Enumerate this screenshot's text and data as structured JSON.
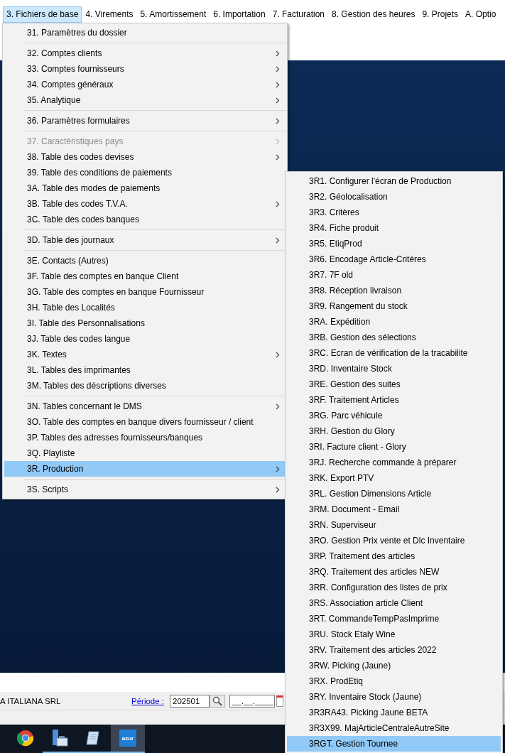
{
  "menubar": [
    {
      "label": "3. Fichiers de base",
      "selected": true
    },
    {
      "label": "4. Virements",
      "selected": false
    },
    {
      "label": "5. Amortissement",
      "selected": false
    },
    {
      "label": "6. Importation",
      "selected": false
    },
    {
      "label": "7. Facturation",
      "selected": false
    },
    {
      "label": "8. Gestion des heures",
      "selected": false
    },
    {
      "label": "9. Projets",
      "selected": false
    },
    {
      "label": "A. Optio",
      "selected": false
    }
  ],
  "menu": [
    {
      "kind": "item",
      "label": "31. Paramètres du dossier",
      "submenu": false,
      "disabled": false,
      "selected": false
    },
    {
      "kind": "separator"
    },
    {
      "kind": "item",
      "label": "32. Comptes clients",
      "submenu": true,
      "disabled": false,
      "selected": false
    },
    {
      "kind": "item",
      "label": "33. Comptes fournisseurs",
      "submenu": true,
      "disabled": false,
      "selected": false
    },
    {
      "kind": "item",
      "label": "34. Comptes généraux",
      "submenu": true,
      "disabled": false,
      "selected": false
    },
    {
      "kind": "item",
      "label": "35. Analytique",
      "submenu": true,
      "disabled": false,
      "selected": false
    },
    {
      "kind": "separator"
    },
    {
      "kind": "item",
      "label": "36. Paramètres formulaires",
      "submenu": true,
      "disabled": false,
      "selected": false
    },
    {
      "kind": "separator"
    },
    {
      "kind": "item",
      "label": "37. Caractèristiques pays",
      "submenu": true,
      "disabled": true,
      "selected": false
    },
    {
      "kind": "item",
      "label": "38. Table des codes devises",
      "submenu": true,
      "disabled": false,
      "selected": false
    },
    {
      "kind": "item",
      "label": "39. Table des conditions de paiements",
      "submenu": false,
      "disabled": false,
      "selected": false
    },
    {
      "kind": "item",
      "label": "3A. Table des modes de paiements",
      "submenu": false,
      "disabled": false,
      "selected": false
    },
    {
      "kind": "item",
      "label": "3B. Table des codes T.V.A.",
      "submenu": true,
      "disabled": false,
      "selected": false
    },
    {
      "kind": "item",
      "label": "3C. Table des codes banques",
      "submenu": false,
      "disabled": false,
      "selected": false
    },
    {
      "kind": "separator"
    },
    {
      "kind": "item",
      "label": "3D. Table des journaux",
      "submenu": true,
      "disabled": false,
      "selected": false
    },
    {
      "kind": "separator"
    },
    {
      "kind": "item",
      "label": "3E. Contacts (Autres)",
      "submenu": false,
      "disabled": false,
      "selected": false
    },
    {
      "kind": "item",
      "label": "3F. Table des comptes en banque Client",
      "submenu": false,
      "disabled": false,
      "selected": false
    },
    {
      "kind": "item",
      "label": "3G. Table des comptes en banque Fournisseur",
      "submenu": false,
      "disabled": false,
      "selected": false
    },
    {
      "kind": "item",
      "label": "3H. Table des Localités",
      "submenu": false,
      "disabled": false,
      "selected": false
    },
    {
      "kind": "item",
      "label": "3I. Table des Personnalisations",
      "submenu": false,
      "disabled": false,
      "selected": false
    },
    {
      "kind": "item",
      "label": "3J. Table des codes langue",
      "submenu": false,
      "disabled": false,
      "selected": false
    },
    {
      "kind": "item",
      "label": "3K. Textes",
      "submenu": true,
      "disabled": false,
      "selected": false
    },
    {
      "kind": "item",
      "label": "3L. Tables des imprimantes",
      "submenu": false,
      "disabled": false,
      "selected": false
    },
    {
      "kind": "item",
      "label": "3M. Tables des déscriptions diverses",
      "submenu": false,
      "disabled": false,
      "selected": false
    },
    {
      "kind": "separator"
    },
    {
      "kind": "item",
      "label": "3N. Tables concernant le DMS",
      "submenu": true,
      "disabled": false,
      "selected": false
    },
    {
      "kind": "item",
      "label": "3O. Table des comptes en banque divers fournisseur / client",
      "submenu": false,
      "disabled": false,
      "selected": false
    },
    {
      "kind": "item",
      "label": "3P. Tables des adresses fournisseurs/banques",
      "submenu": false,
      "disabled": false,
      "selected": false
    },
    {
      "kind": "item",
      "label": "3Q. Playliste",
      "submenu": false,
      "disabled": false,
      "selected": false
    },
    {
      "kind": "item",
      "label": "3R. Production",
      "submenu": true,
      "disabled": false,
      "selected": true
    },
    {
      "kind": "separator"
    },
    {
      "kind": "item",
      "label": "3S. Scripts",
      "submenu": true,
      "disabled": false,
      "selected": false
    }
  ],
  "submenu": [
    {
      "label": "3R1. Configurer l'écran de Production",
      "selected": false
    },
    {
      "label": "3R2. Géolocalisation",
      "selected": false
    },
    {
      "label": "3R3. Critères",
      "selected": false
    },
    {
      "label": "3R4. Fiche produit",
      "selected": false
    },
    {
      "label": "3R5. EtiqProd",
      "selected": false
    },
    {
      "label": "3R6. Encodage Article-Critères",
      "selected": false
    },
    {
      "label": "3R7. 7F old",
      "selected": false
    },
    {
      "label": "3R8. Réception livraison",
      "selected": false
    },
    {
      "label": "3R9. Rangement du stock",
      "selected": false
    },
    {
      "label": "3RA. Expédition",
      "selected": false
    },
    {
      "label": "3RB. Gestion des sélections",
      "selected": false
    },
    {
      "label": "3RC. Ecran de vérification de la tracabilite",
      "selected": false
    },
    {
      "label": "3RD. Inventaire Stock",
      "selected": false
    },
    {
      "label": "3RE. Gestion des suites",
      "selected": false
    },
    {
      "label": "3RF. Traitement Articles",
      "selected": false
    },
    {
      "label": "3RG. Parc véhicule",
      "selected": false
    },
    {
      "label": "3RH. Gestion du Glory",
      "selected": false
    },
    {
      "label": "3RI. Facture client - Glory",
      "selected": false
    },
    {
      "label": "3RJ. Recherche commande à préparer",
      "selected": false
    },
    {
      "label": "3RK. Export PTV",
      "selected": false
    },
    {
      "label": "3RL. Gestion Dimensions Article",
      "selected": false
    },
    {
      "label": "3RM. Document - Email",
      "selected": false
    },
    {
      "label": "3RN. Superviseur",
      "selected": false
    },
    {
      "label": "3RO. Gestion Prix vente et Dlc Inventaire",
      "selected": false
    },
    {
      "label": "3RP. Traitement des articles",
      "selected": false
    },
    {
      "label": "3RQ. Traitement des articles NEW",
      "selected": false
    },
    {
      "label": "3RR. Configuration des listes de prix",
      "selected": false
    },
    {
      "label": "3RS. Association article Client",
      "selected": false
    },
    {
      "label": "3RT. CommandeTempPasImprime",
      "selected": false
    },
    {
      "label": "3RU. Stock Etaly Wine",
      "selected": false
    },
    {
      "label": "3RV. Traitement des articles 2022",
      "selected": false
    },
    {
      "label": "3RW. Picking (Jaune)",
      "selected": false
    },
    {
      "label": "3RX. ProdEtiq",
      "selected": false
    },
    {
      "label": "3RY. Inventaire Stock (Jaune)",
      "selected": false
    },
    {
      "label": "3R3RA43. Picking Jaune BETA",
      "selected": false
    },
    {
      "label": "3R3X99. MajArticleCentraleAutreSite",
      "selected": false
    },
    {
      "label": "3RGT. Gestion Tournee",
      "selected": true
    }
  ],
  "status_bar": {
    "company": "A ITALIANA SRL",
    "period_label": "Période :",
    "period_value": "202501",
    "date_value": "__.__.____"
  },
  "taskbar": [
    {
      "kind": "browser",
      "running": false,
      "selected": false
    },
    {
      "kind": "server",
      "running": true,
      "selected": false
    },
    {
      "kind": "notepad",
      "running": true,
      "selected": false
    },
    {
      "kind": "azur",
      "label": "azur",
      "running": true,
      "selected": true
    }
  ]
}
